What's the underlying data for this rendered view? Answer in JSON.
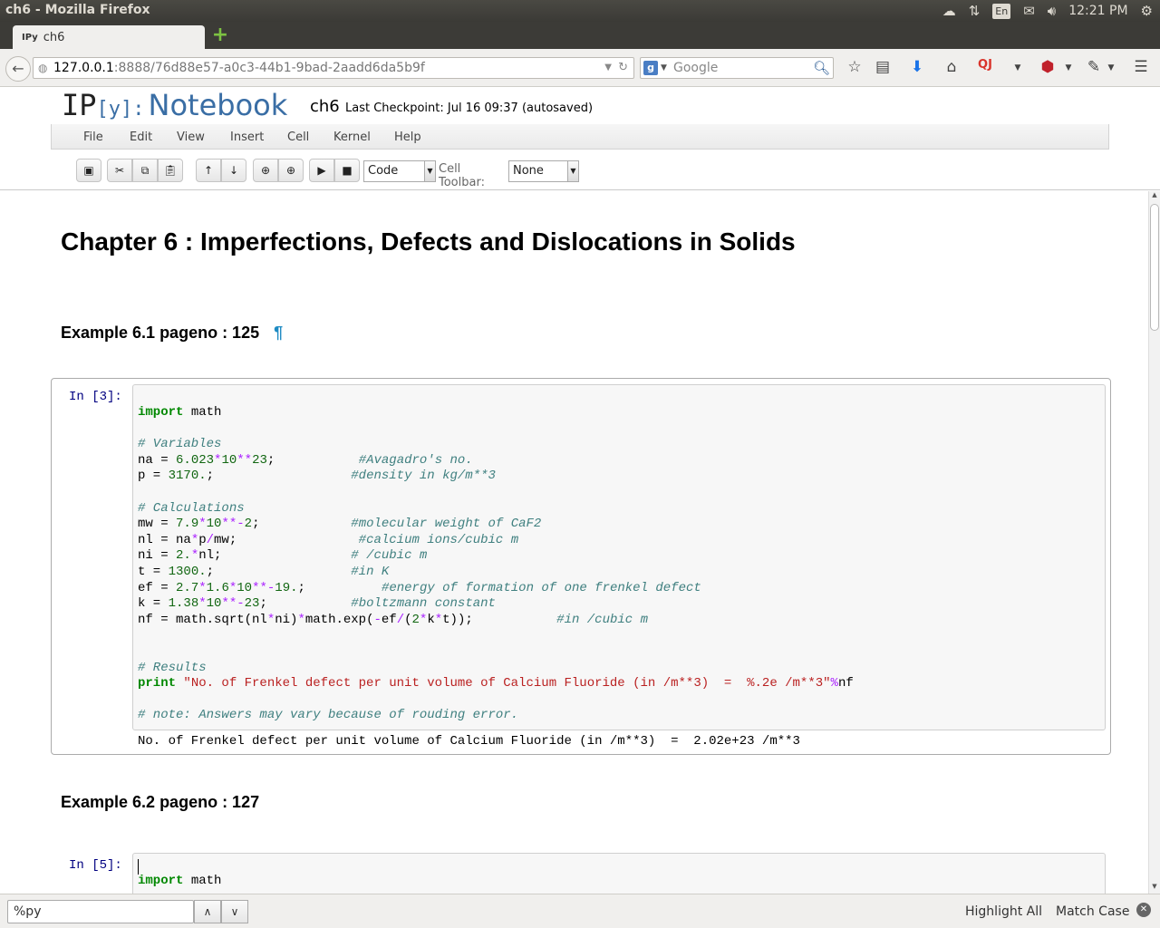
{
  "os": {
    "window_title": "ch6 - Mozilla Firefox",
    "keyboard_layout": "En",
    "clock": "12:21 PM"
  },
  "browser": {
    "tab_title": "ch6",
    "tab_icon_text": "IPy",
    "url_host": "127.0.0.1",
    "url_path": ":8888/76d88e57-a0c3-44b1-9bad-2aadd6da5b9f",
    "search_placeholder": "Google",
    "search_engine_letter": "g"
  },
  "notebook": {
    "logo_ip": "IP",
    "logo_y": "[y]:",
    "logo_notebook": "Notebook",
    "name": "ch6",
    "checkpoint": "Last Checkpoint: Jul 16 09:37 (autosaved)",
    "menu": [
      "File",
      "Edit",
      "View",
      "Insert",
      "Cell",
      "Kernel",
      "Help"
    ],
    "cell_type": "Code",
    "cell_toolbar_label": "Cell Toolbar:",
    "cell_toolbar_value": "None"
  },
  "content": {
    "chapter_title": "Chapter 6 : Imperfections, Defects and Dislocations in Solids",
    "example1_title": "Example 6.1 pageno : 125",
    "anchor": "¶",
    "cell1_prompt": "In [3]:",
    "cell1_output": "No. of Frenkel defect per unit volume of Calcium Fluoride (in /m**3)  =  2.02e+23 /m**3",
    "example2_title": "Example 6.2 pageno : 127",
    "cell2_prompt": "In [5]:",
    "cell2_first_line": "import math"
  },
  "findbar": {
    "query": "%py",
    "highlight_all": "Highlight All",
    "match_case": "Match Case"
  }
}
